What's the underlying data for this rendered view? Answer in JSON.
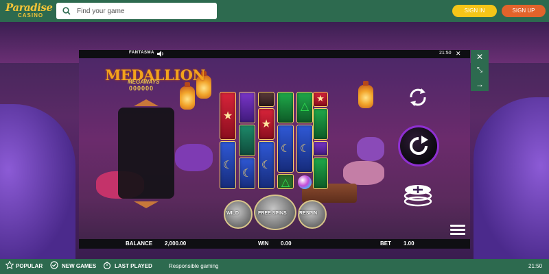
{
  "header": {
    "logo_line1": "Paradise",
    "logo_line2": "CASINO",
    "search_placeholder": "Find your game",
    "sign_in_label": "SIGN IN",
    "sign_up_label": "SIGN UP"
  },
  "game": {
    "provider": "FANTASMA",
    "clock": "21:50",
    "title": "MEDALLION",
    "subtitle": "MEGAWAYS",
    "ways_count": "000000",
    "tools": [
      "close-icon",
      "collapse-icon",
      "arrow-right-icon"
    ],
    "balance_label": "BALANCE",
    "balance_value": "2,000.00",
    "win_label": "WIN",
    "win_value": "0.00",
    "bet_label": "BET",
    "bet_value": "1.00",
    "medallions": [
      "WILD",
      "FREE SPINS",
      "RESPIN"
    ],
    "colors": {
      "header_green": "#2d6a4f",
      "sign_in": "#f5c518",
      "sign_up": "#e2632b",
      "spin_ring": "#8e2fd1",
      "title_gold": "#f2a31c"
    }
  },
  "footer": {
    "popular_label": "POPULAR",
    "new_games_label": "NEW GAMES",
    "last_played_label": "LAST PLAYED",
    "responsible_label": "Responsible gaming",
    "time": "21:50"
  }
}
